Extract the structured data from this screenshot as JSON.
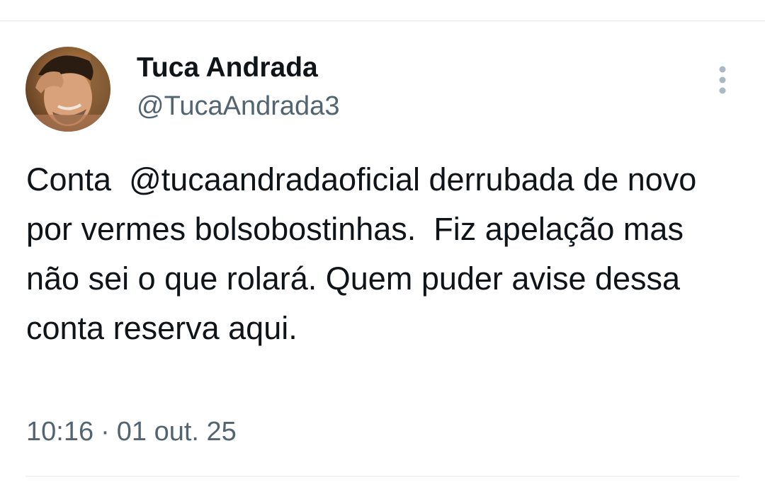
{
  "tweet": {
    "author": {
      "display_name": "Tuca Andrada",
      "handle": "@TucaAndrada3",
      "avatar_icon": "profile-photo"
    },
    "text": "Conta  @tucaandradaoficial derrubada de novo por vermes bolsobostinhas.  Fiz apelação mas não sei o que rolará. Quem puder avise dessa conta reserva aqui.",
    "time": "10:16",
    "separator": "·",
    "date": "01 out. 25"
  },
  "icons": {
    "more": "more-vertical-icon"
  },
  "colors": {
    "text_primary": "#0f1419",
    "text_secondary": "#536471",
    "divider": "#e6e9eb"
  }
}
